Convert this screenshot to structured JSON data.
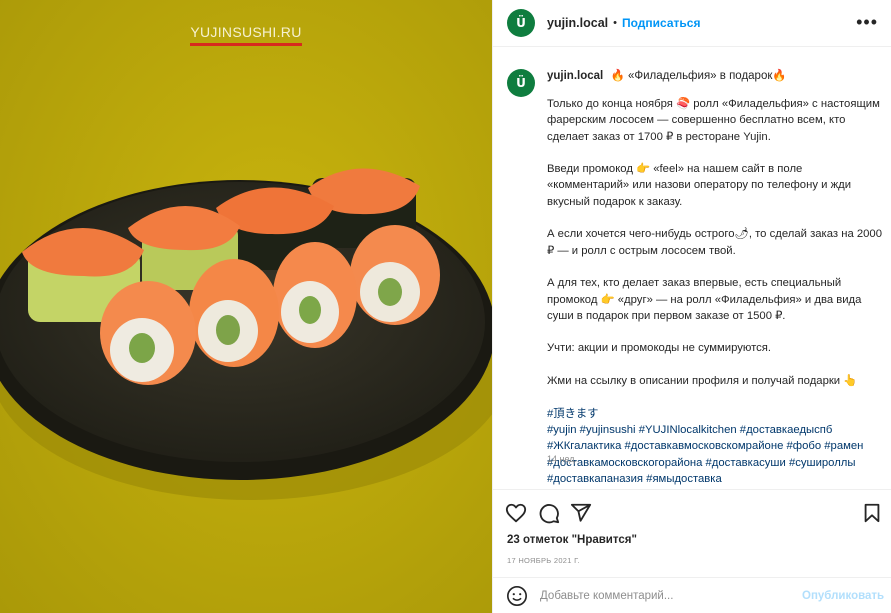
{
  "media": {
    "watermark": "YUJINSUSHI.RU",
    "colors": {
      "background": "#b9a70b",
      "plate": "#2b2a20",
      "salmon": "#f07a3e",
      "nori": "#1e2216",
      "cucumber": "#b9c95a"
    }
  },
  "header": {
    "avatar_letter": "Ü",
    "username": "yujin.local",
    "dot": "•",
    "follow_label": "Подписаться",
    "more_label": "•••"
  },
  "caption": {
    "avatar_letter": "Ü",
    "username": "yujin.local",
    "title": "🔥 «Филадельфия» в подарок🔥",
    "paragraphs": [
      "Только до конца ноября 🍣 ролл «Филадельфия» с настоящим фарерским лососем — совершенно бесплатно всем, кто сделает заказ от 1700 ₽ в ресторане Yujin.",
      "Введи промокод 👉 «feel» на нашем сайт в поле «комментарий» или назови оператору по телефону и жди вкусный подарок к заказу.",
      "А если хочется чего-нибудь острого🌶, то сделай заказ на 2000 ₽ — и ролл с острым лососем твой.",
      "А для тех, кто делает заказ впервые, есть специальный промокод 👉 «друг» — на ролл «Филадельфия» и два вида суши в подарок при первом заказе от 1500 ₽.",
      "Учти: акции и промокоды не суммируются.",
      "Жми на ссылку в описании профиля и получай подарки 👆"
    ],
    "hashtags": [
      "#頂きます",
      "#yujin",
      "#yujinsushi",
      "#YUJINlocalkitchen",
      "#доставкаедыспб",
      "#ЖКгалактика",
      "#доставкавмосковскомрайоне",
      "#фобо",
      "#рамен",
      "#доставкамосковскогорайона",
      "#доставкасуши",
      "#сушироллы",
      "#доставкапаназия",
      "#ямыдоставка"
    ],
    "time_ago": "14 нед."
  },
  "actions": {
    "likes_text": "23 отметок \"Нравится\"",
    "date": "17 НОЯБРЬ 2021 Г."
  },
  "comment": {
    "placeholder": "Добавьте комментарий...",
    "publish_label": "Опубликовать"
  }
}
